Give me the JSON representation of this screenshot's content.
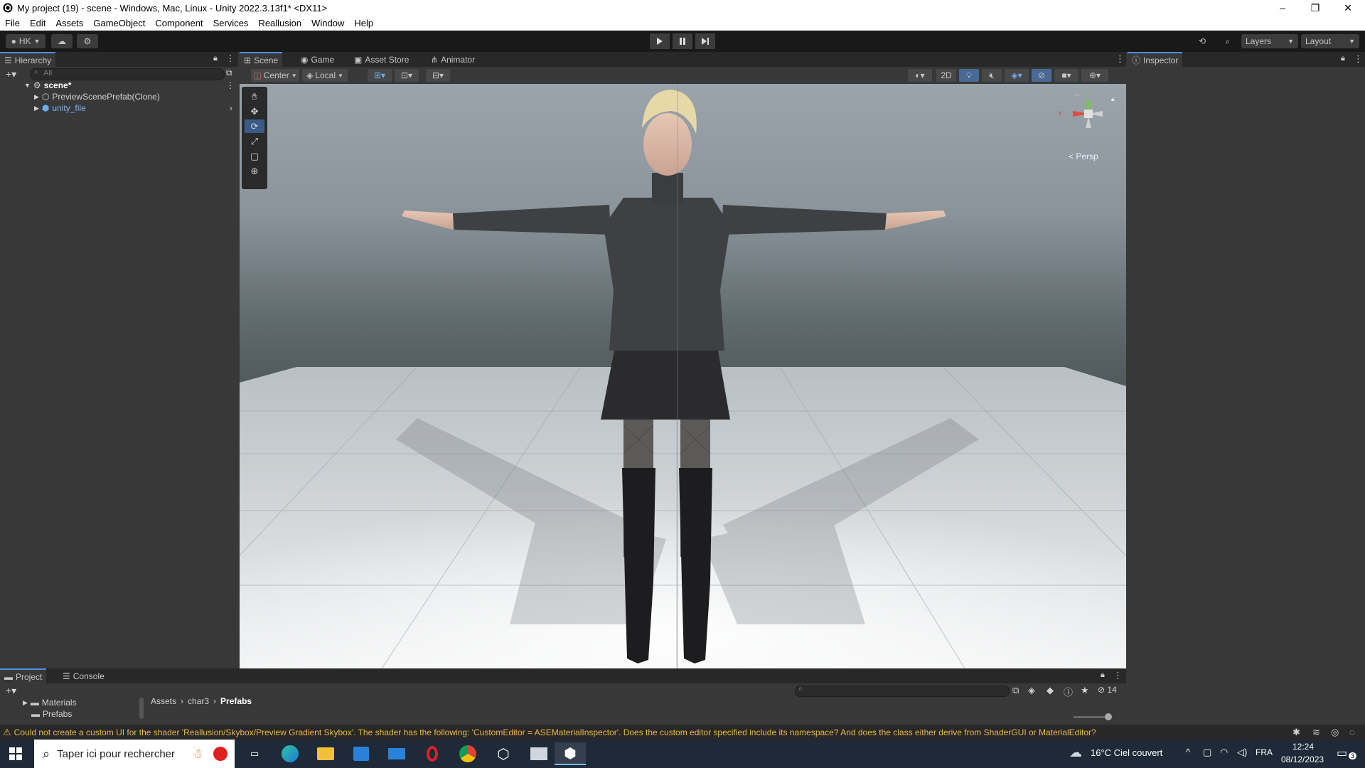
{
  "window": {
    "title": "My project (19) - scene - Windows, Mac, Linux - Unity 2022.3.13f1* <DX11>",
    "controls": {
      "minimize": "–",
      "maximize": "❐",
      "close": "✕"
    }
  },
  "menu": [
    "File",
    "Edit",
    "Assets",
    "GameObject",
    "Component",
    "Services",
    "Reallusion",
    "Window",
    "Help"
  ],
  "toolbar": {
    "account": "HK",
    "layers": "Layers",
    "layout": "Layout"
  },
  "hierarchy": {
    "tab": "Hierarchy",
    "search_placeholder": "All",
    "items": [
      {
        "label": "scene*"
      },
      {
        "label": "PreviewScenePrefab(Clone)"
      },
      {
        "label": "unity_file"
      }
    ]
  },
  "scene_tabs": [
    "Scene",
    "Game",
    "Asset Store",
    "Animator"
  ],
  "scene_toolbar": {
    "pivot": "Center",
    "space": "Local",
    "mode2d": "2D"
  },
  "gizmo": {
    "axis_y": "y",
    "axis_x": "x",
    "projection": "Persp"
  },
  "inspector": {
    "tab": "Inspector"
  },
  "bottom_tabs": [
    "Project",
    "Console"
  ],
  "project": {
    "folders": [
      "Materials",
      "Prefabs"
    ],
    "breadcrumb": [
      "Assets",
      "char3",
      "Prefabs"
    ],
    "hidden_count": "14"
  },
  "status": {
    "message": "Could not create a custom UI for the shader 'Reallusion/Skybox/Preview Gradient Skybox'. The shader has the following: 'CustomEditor = ASEMaterialInspector'. Does the custom editor specified include its namespace? And does the class either derive from ShaderGUI or MaterialEditor?"
  },
  "taskbar": {
    "search_placeholder": "Taper ici pour rechercher",
    "weather": "16°C  Ciel couvert",
    "language": "FRA",
    "time": "12:24",
    "date": "08/12/2023",
    "notifications": "3"
  },
  "colors": {
    "accent": "#4d90e0",
    "warning": "#e8b84b",
    "selected_tool": "#3a5a88"
  }
}
